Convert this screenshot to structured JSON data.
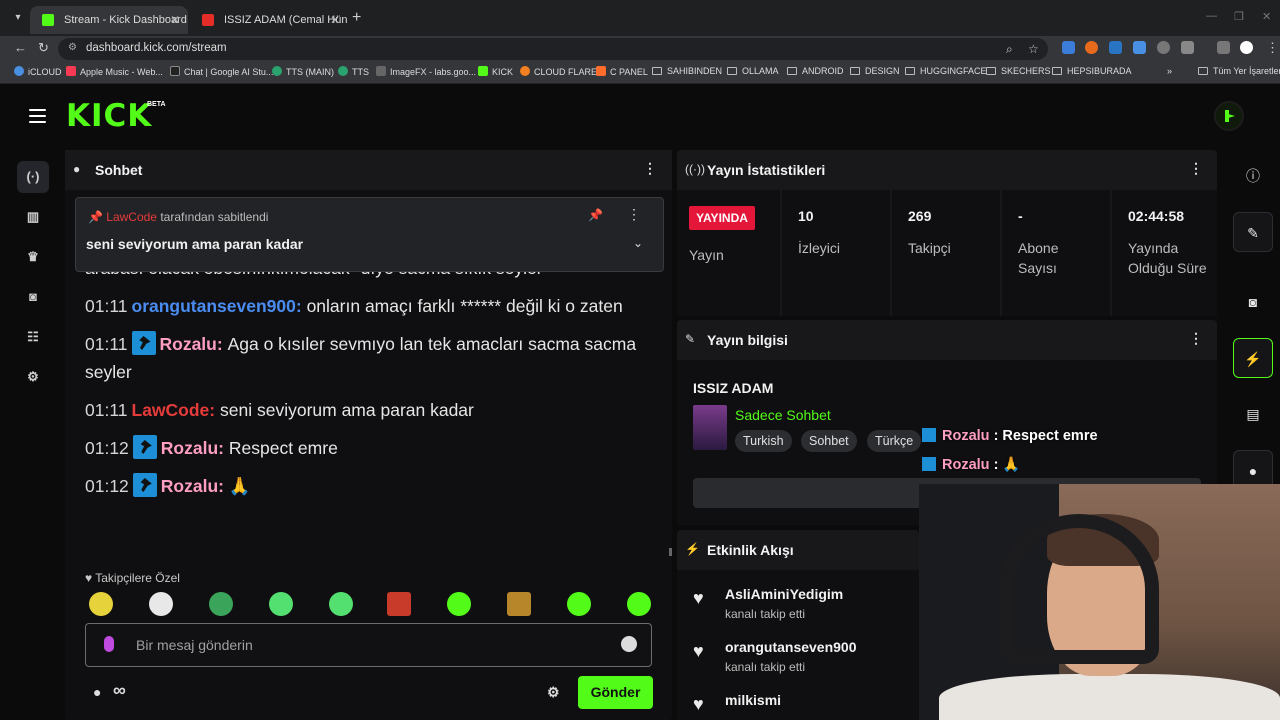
{
  "browser": {
    "tabs": [
      {
        "title": "Stream - Kick Dashboard",
        "active": true
      },
      {
        "title": "ISSIZ ADAM (Cemal Hünal, Meli…",
        "active": false
      }
    ],
    "url": "dashboard.kick.com/stream",
    "bookmarks": [
      "iCLOUD",
      "Apple Music - Web...",
      "Chat | Google AI Stu...",
      "TTS (MAIN)",
      "TTS",
      "ImageFX - labs.goo...",
      "KICK",
      "CLOUD FLARE",
      "C PANEL",
      "SAHIBINDEN",
      "OLLAMA",
      "ANDROID",
      "DESIGN",
      "HUGGINGFACE",
      "SKECHERS",
      "HEPSIBURADA"
    ],
    "bookmarks_overflow": "»",
    "all_bookmarks": "Tüm Yer İşaretleri"
  },
  "header": {
    "logo": "KICK",
    "beta": "BETA"
  },
  "chat": {
    "title": "Sohbet",
    "pinned": {
      "user": "LawCode",
      "suffix": "tarafından sabitlendi",
      "message": "seni seviyorum ama paran kadar"
    },
    "partial_line": "arabası olacak ebesınınkımolacak\" dıye sacma sıkık seyler",
    "messages": [
      {
        "time": "01:11",
        "user": "orangutanseven900",
        "color": "#4a8cf0",
        "badge": false,
        "text": "onların amaçı farklı ****** değil ki o zaten"
      },
      {
        "time": "01:11",
        "user": "Rozalu",
        "color": "#ff9ec3",
        "badge": true,
        "text": "Aga o kısıler sevmıyo lan tek amacları sacma sacma seyler"
      },
      {
        "time": "01:11",
        "user": "LawCode",
        "color": "#e63b3b",
        "badge": false,
        "text": "seni seviyorum ama paran kadar"
      },
      {
        "time": "01:12",
        "user": "Rozalu",
        "color": "#ff9ec3",
        "badge": true,
        "text": "Respect emre"
      },
      {
        "time": "01:12",
        "user": "Rozalu",
        "color": "#ff9ec3",
        "badge": true,
        "text": "🙏"
      }
    ],
    "followers_only_label": "Takipçilere Özel",
    "input_placeholder": "Bir mesaj gönderin",
    "infinity": "∞",
    "send_label": "Gönder"
  },
  "stats": {
    "title": "Yayın İstatistikleri",
    "live_badge": "YAYINDA",
    "live_label": "Yayın",
    "cells": [
      {
        "value": "10",
        "label": "İzleyici"
      },
      {
        "value": "269",
        "label": "Takipçi"
      },
      {
        "value": "-",
        "label": "Abone Sayısı"
      },
      {
        "value": "02:44:58",
        "label": "Yayında Olduğu Süre"
      }
    ]
  },
  "info": {
    "title": "Yayın bilgisi",
    "stream_title": "ISSIZ ADAM",
    "category": "Sadece Sohbet",
    "tags": [
      "Turkish",
      "Sohbet",
      "Türkçe"
    ]
  },
  "overlay": [
    {
      "user": "Rozalu",
      "text": ": Respect emre"
    },
    {
      "user": "Rozalu",
      "text": ": 🙏"
    }
  ],
  "activity": {
    "title": "Etkinlik Akışı",
    "items": [
      {
        "user": "AsliAminiYedigim",
        "action": "kanalı takip etti"
      },
      {
        "user": "orangutanseven900",
        "action": "kanalı takip etti"
      },
      {
        "user": "milkismi",
        "action": ""
      }
    ]
  },
  "colors": {
    "accent": "#53fc18",
    "live": "#e4163a",
    "bg": "#0b0b0c",
    "panel": "#18181b"
  }
}
